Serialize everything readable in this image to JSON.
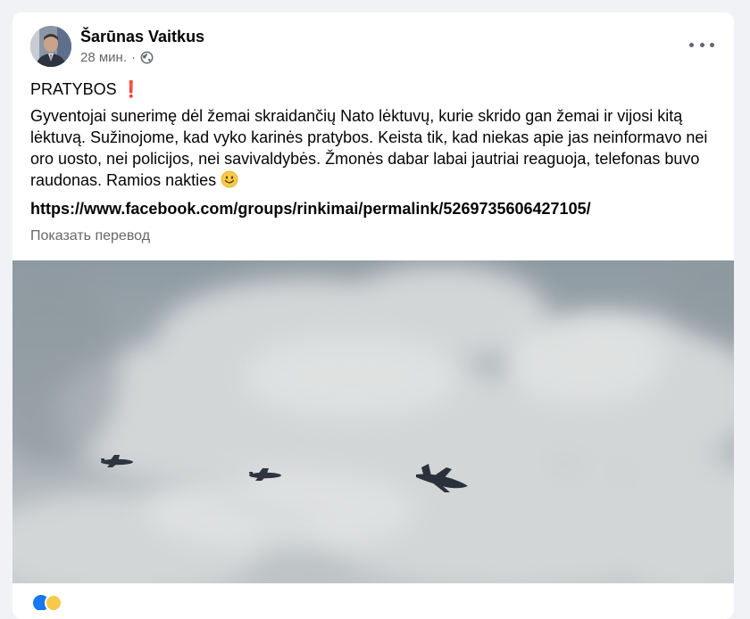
{
  "post": {
    "author": "Šarūnas Vaitkus",
    "time": "28 мин.",
    "separator": "·",
    "privacy_icon": "globe-icon",
    "headline": "PRATYBOS",
    "headline_emoji": "❗",
    "text": "Gyventojai sunerimę dėl žemai skraidančių Nato lėktuvų, kurie skrido gan žemai ir vijosi kitą lėktuvą. Sužinojome, kad vyko karinės pratybos. Keista tik, kad niekas apie jas neinformavo nei oro uosto, nei policijos, nei savivaldybės. Žmonės dabar labai jautriai reaguoja, telefonas buvo raudonas. Ramios nakties",
    "text_emoji": "slightly-smiling-face-icon",
    "link": "https://www.facebook.com/groups/rinkimai/permalink/5269735606427105/",
    "translate_label": "Показать перевод",
    "more_icon": "more-options-icon",
    "media_description_icon": "photo"
  },
  "colors": {
    "background": "#f0f2f5",
    "card": "#ffffff",
    "secondary_text": "#65676b",
    "primary_text": "#050505",
    "sky": "#aab1b6"
  }
}
